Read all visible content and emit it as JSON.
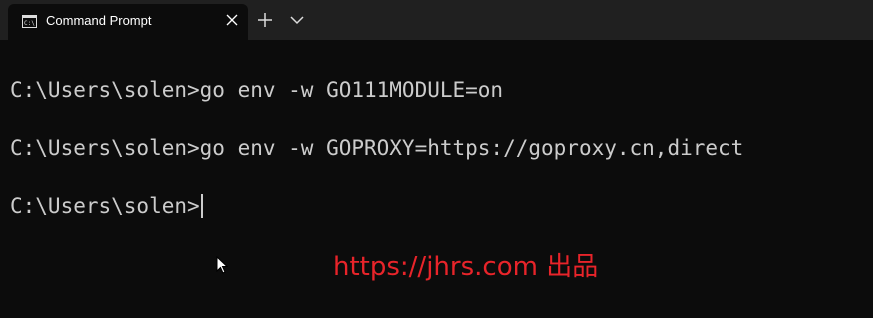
{
  "tab": {
    "title": "Command Prompt",
    "icon": "command-prompt-icon"
  },
  "controls": {
    "close_icon": "close-icon",
    "new_tab_icon": "plus-icon",
    "dropdown_icon": "chevron-down-icon"
  },
  "terminal": {
    "lines": [
      "C:\\Users\\solen>go env -w GO111MODULE=on",
      "C:\\Users\\solen>go env -w GOPROXY=https://goproxy.cn,direct",
      "C:\\Users\\solen>"
    ]
  },
  "watermark": "https://jhrs.com 出品",
  "colors": {
    "background": "#0c0c0c",
    "tabbar": "#202020",
    "text": "#cccccc",
    "watermark": "#e8242a"
  }
}
